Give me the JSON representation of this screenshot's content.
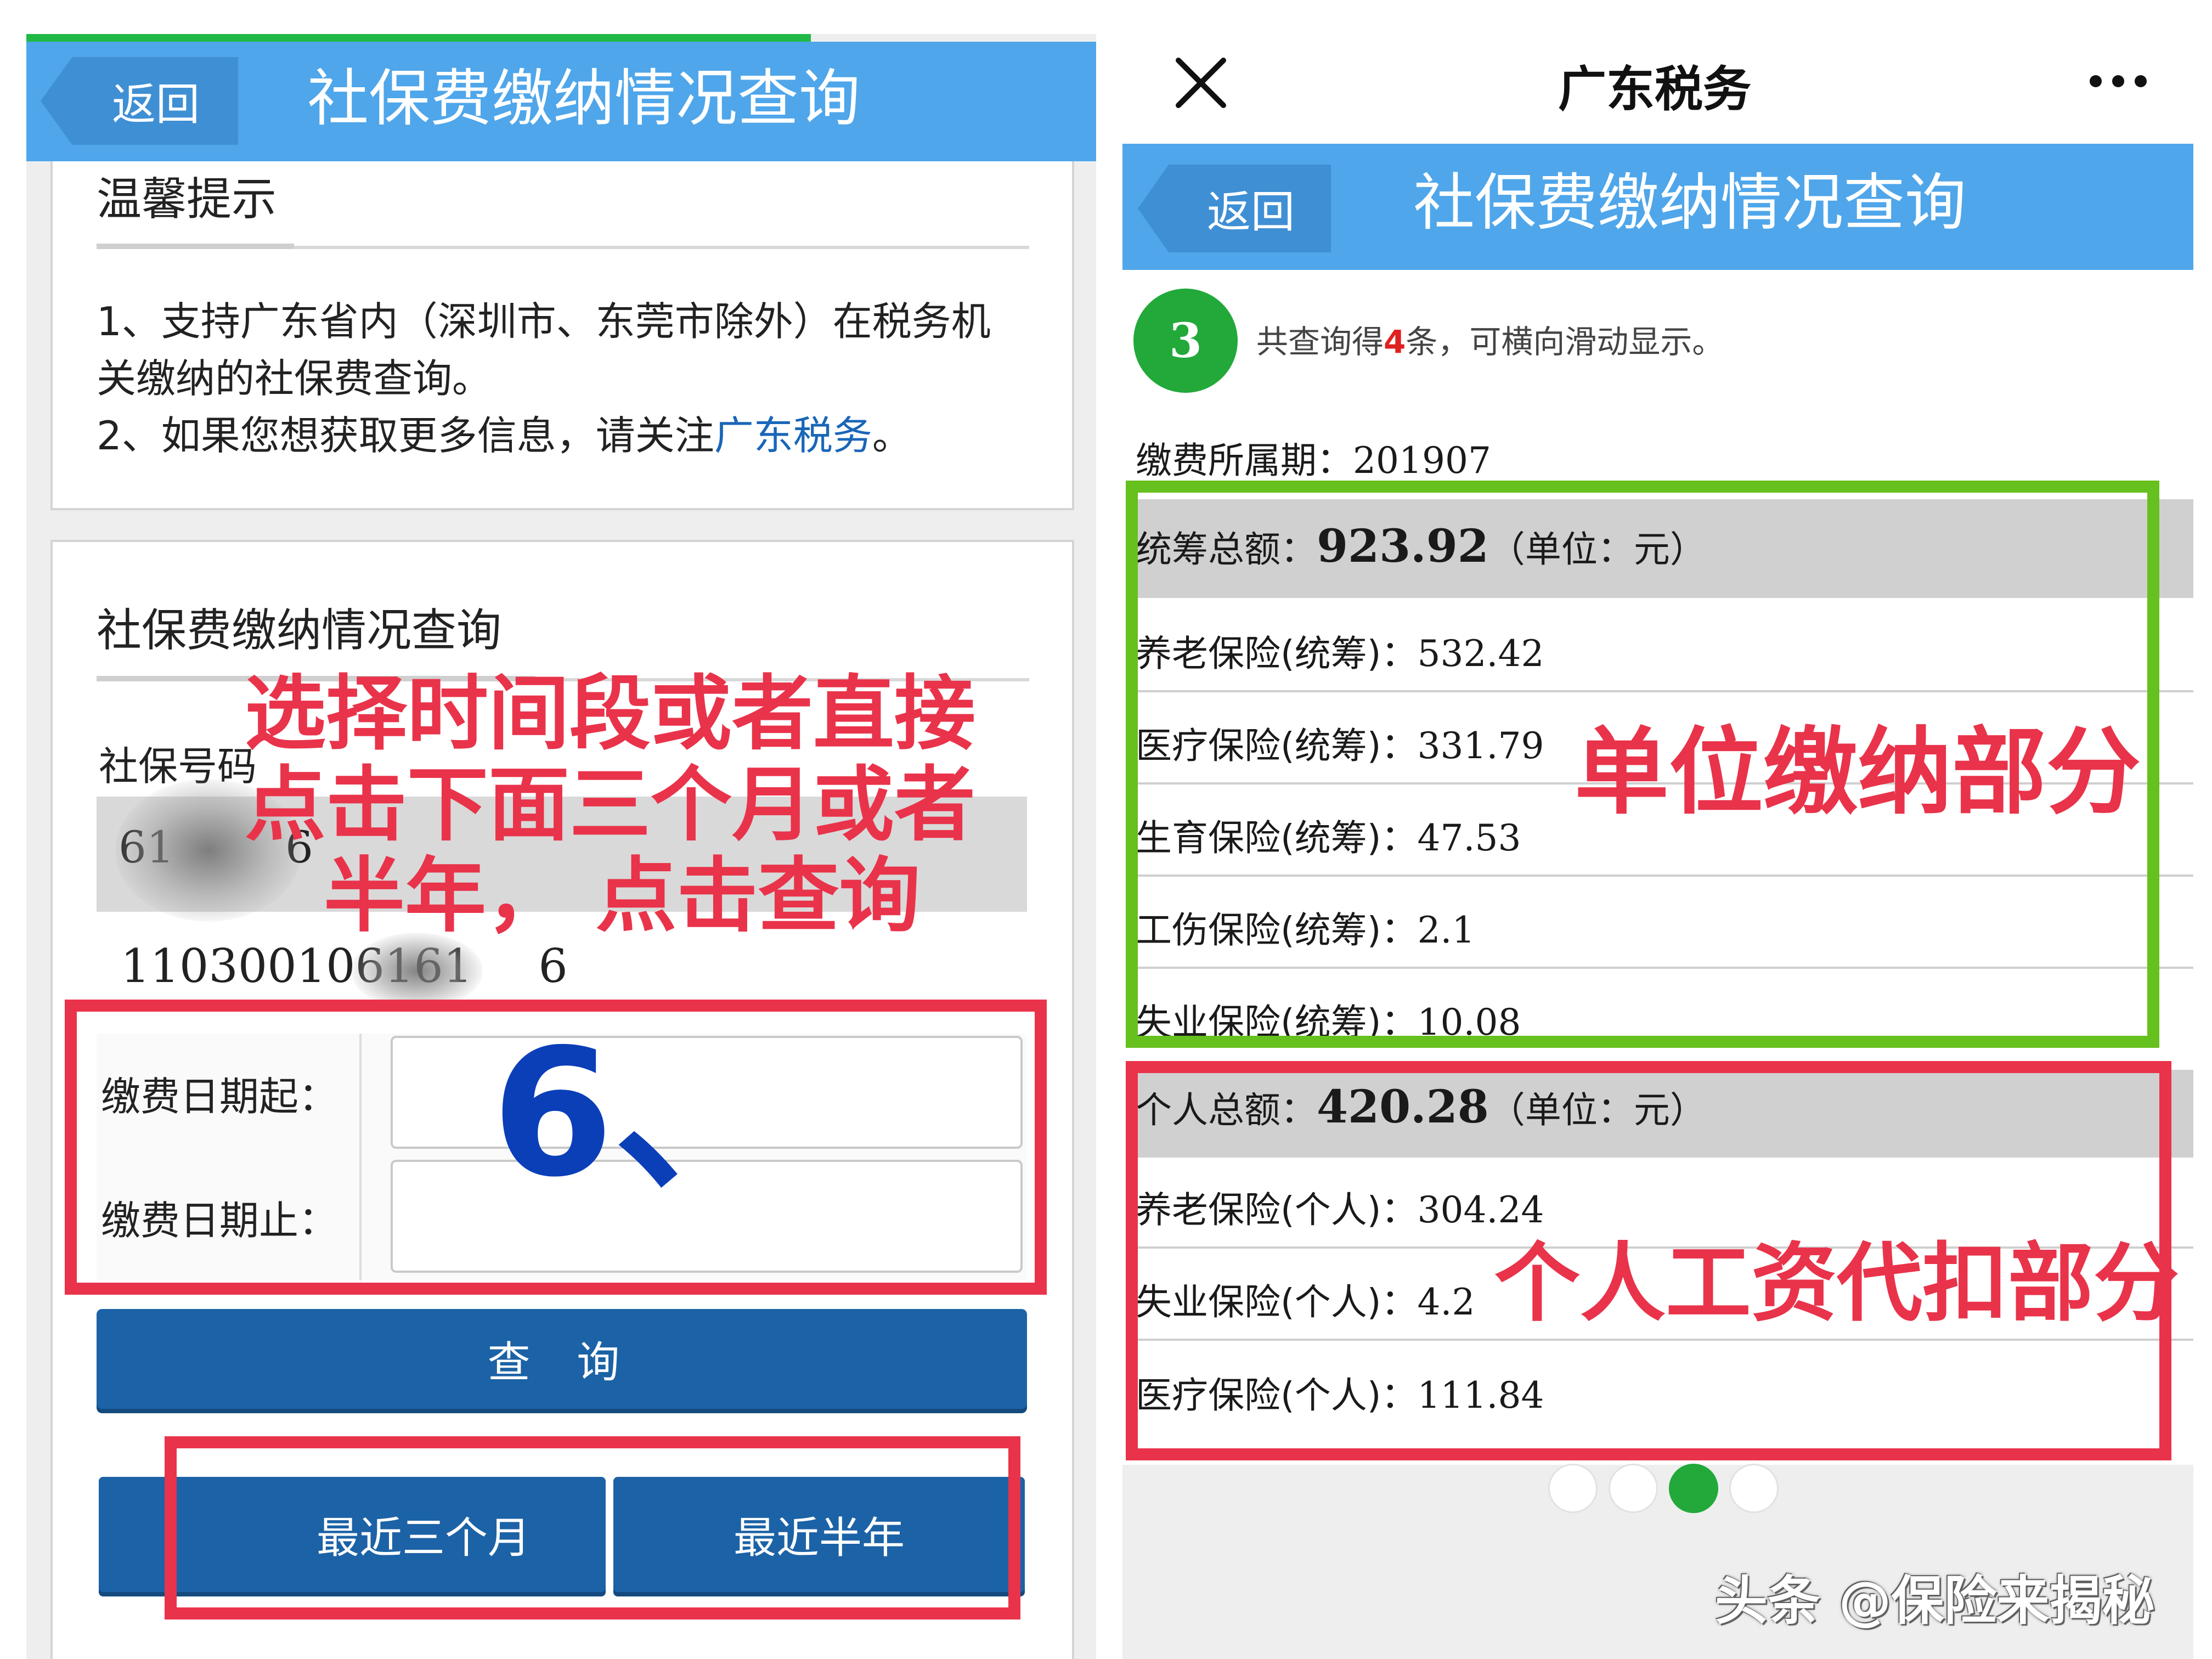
{
  "left": {
    "header": {
      "back_label": "返回",
      "title": "社保费缴纳情况查询"
    },
    "tips": {
      "title": "温馨提示",
      "line1": "1、支持广东省内（深圳市、东莞市除外）在税务机",
      "line2": "关缴纳的社保费查询。",
      "line3_prefix": "2、如果您想获取更多信息，请关注",
      "line3_link": "广东税务",
      "line3_suffix": "。"
    },
    "query": {
      "title": "社保费缴纳情况查询",
      "ssn_label": "社保号码",
      "ssn_value_partial_start": "61",
      "ssn_value_partial_end": "6",
      "account_prefix": "110300106161",
      "account_suffix": "6",
      "date_start_label": "缴费日期起：",
      "date_end_label": "缴费日期止：",
      "date_start_value": "",
      "date_end_value": "",
      "submit_label": "查 询",
      "quick_3m_label": "最近三个月",
      "quick_6m_label": "最近半年"
    },
    "annotations": {
      "instruction_line1": "选择时间段或者直接",
      "instruction_line2": "点击下面三个月或者",
      "instruction_line3": "半年，  点击查询",
      "step_number": "6、"
    }
  },
  "right": {
    "topbar": {
      "close_icon": "close-icon",
      "title": "广东税务",
      "more_icon": "more-icon"
    },
    "header": {
      "back_label": "返回",
      "title": "社保费缴纳情况查询"
    },
    "result": {
      "badge": "3",
      "summary_prefix": "共查询得",
      "summary_count": "4",
      "summary_suffix": "条，可横向滑动显示。",
      "period_label": "缴费所属期：",
      "period_value": "201907"
    },
    "employer": {
      "total_label": "统筹总额：",
      "total_value": "923.92",
      "unit": "（单位：元）",
      "items": [
        {
          "label": "养老保险(统筹)：",
          "value": "532.42"
        },
        {
          "label": "医疗保险(统筹)：",
          "value": "331.79"
        },
        {
          "label": "生育保险(统筹)：",
          "value": "47.53"
        },
        {
          "label": "工伤保险(统筹)：",
          "value": "2.1"
        },
        {
          "label": "失业保险(统筹)：",
          "value": "10.08"
        }
      ]
    },
    "personal": {
      "total_label": "个人总额：",
      "total_value": "420.28",
      "unit": "（单位：元）",
      "items": [
        {
          "label": "养老保险(个人)：",
          "value": "304.24"
        },
        {
          "label": "失业保险(个人)：",
          "value": "4.2"
        },
        {
          "label": "医疗保险(个人)：",
          "value": "111.84"
        }
      ]
    },
    "annotations": {
      "employer_part": "单位缴纳部分",
      "personal_part": "个人工资代扣部分"
    },
    "pagination": {
      "total": 4,
      "active_index": 2
    },
    "watermark": "头条 @保险来揭秘"
  },
  "colors": {
    "header_blue": "#4fa6ea",
    "button_blue": "#1c62a6",
    "annotation_red": "#e9334a",
    "annotation_green": "#66c01d",
    "step_blue": "#0b3fb8",
    "badge_green": "#22a93a"
  }
}
